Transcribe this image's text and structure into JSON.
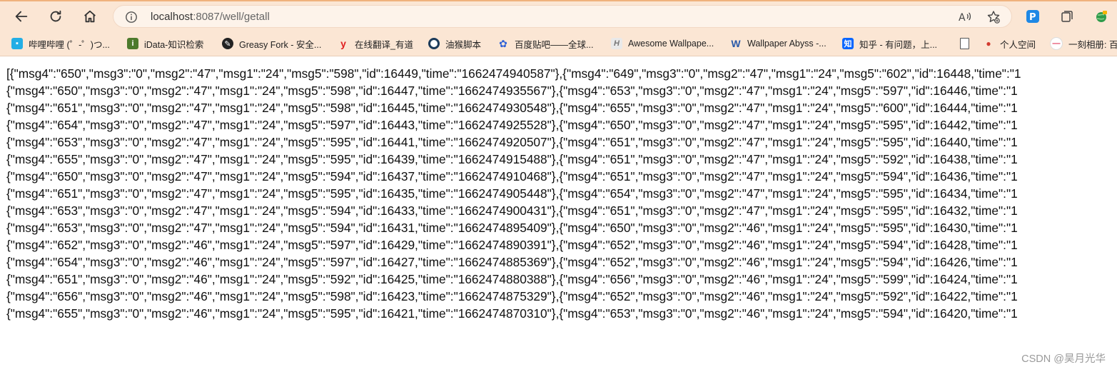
{
  "browser": {
    "address_bar": {
      "host": "localhost",
      "path": ":8087/well/getall"
    },
    "nav": {
      "back_icon": "back-arrow-icon",
      "reload_icon": "reload-icon",
      "home_icon": "home-icon"
    },
    "bookmarks": [
      {
        "label": "哔哩哔哩 (゜-゜)つ...",
        "icon": "bilibili-icon",
        "color": "#23aee5"
      },
      {
        "label": "iData-知识检索",
        "icon": "idata-icon",
        "color": "#4d7a2c"
      },
      {
        "label": "Greasy Fork - 安全...",
        "icon": "greasyfork-icon",
        "color": "#222222"
      },
      {
        "label": "在线翻译_有道",
        "icon": "youdao-icon",
        "color": "#e02020"
      },
      {
        "label": "油猴脚本",
        "icon": "tampermonkey-icon",
        "color": "#1c3b5a"
      },
      {
        "label": "百度贴吧——全球...",
        "icon": "baidu-icon",
        "color": "#2f61d6"
      },
      {
        "label": "Awesome Wallpape...",
        "icon": "wallpaper-icon",
        "color": "#8a8a8a"
      },
      {
        "label": "Wallpaper Abyss -...",
        "icon": "abyss-icon",
        "color": "#2b5aa8"
      },
      {
        "label": "知乎 - 有问题，上...",
        "icon": "zhihu-icon",
        "color": "#0a66ff"
      },
      {
        "label": "",
        "icon": "document-icon",
        "color": "#555555"
      },
      {
        "label": "个人空间",
        "icon": "space-icon",
        "color": "#d23a2f"
      },
      {
        "label": "一刻相册: 百",
        "icon": "yike-icon",
        "color": "#e23b5b"
      }
    ]
  },
  "response_lines": [
    "[{\"msg4\":\"650\",\"msg3\":\"0\",\"msg2\":\"47\",\"msg1\":\"24\",\"msg5\":\"598\",\"id\":16449,\"time\":\"1662474940587\"},{\"msg4\":\"649\",\"msg3\":\"0\",\"msg2\":\"47\",\"msg1\":\"24\",\"msg5\":\"602\",\"id\":16448,\"time\":\"1",
    "{\"msg4\":\"650\",\"msg3\":\"0\",\"msg2\":\"47\",\"msg1\":\"24\",\"msg5\":\"598\",\"id\":16447,\"time\":\"1662474935567\"},{\"msg4\":\"653\",\"msg3\":\"0\",\"msg2\":\"47\",\"msg1\":\"24\",\"msg5\":\"597\",\"id\":16446,\"time\":\"1",
    "{\"msg4\":\"651\",\"msg3\":\"0\",\"msg2\":\"47\",\"msg1\":\"24\",\"msg5\":\"598\",\"id\":16445,\"time\":\"1662474930548\"},{\"msg4\":\"655\",\"msg3\":\"0\",\"msg2\":\"47\",\"msg1\":\"24\",\"msg5\":\"600\",\"id\":16444,\"time\":\"1",
    "{\"msg4\":\"654\",\"msg3\":\"0\",\"msg2\":\"47\",\"msg1\":\"24\",\"msg5\":\"597\",\"id\":16443,\"time\":\"1662474925528\"},{\"msg4\":\"650\",\"msg3\":\"0\",\"msg2\":\"47\",\"msg1\":\"24\",\"msg5\":\"595\",\"id\":16442,\"time\":\"1",
    "{\"msg4\":\"653\",\"msg3\":\"0\",\"msg2\":\"47\",\"msg1\":\"24\",\"msg5\":\"595\",\"id\":16441,\"time\":\"1662474920507\"},{\"msg4\":\"651\",\"msg3\":\"0\",\"msg2\":\"47\",\"msg1\":\"24\",\"msg5\":\"595\",\"id\":16440,\"time\":\"1",
    "{\"msg4\":\"655\",\"msg3\":\"0\",\"msg2\":\"47\",\"msg1\":\"24\",\"msg5\":\"595\",\"id\":16439,\"time\":\"1662474915488\"},{\"msg4\":\"651\",\"msg3\":\"0\",\"msg2\":\"47\",\"msg1\":\"24\",\"msg5\":\"592\",\"id\":16438,\"time\":\"1",
    "{\"msg4\":\"650\",\"msg3\":\"0\",\"msg2\":\"47\",\"msg1\":\"24\",\"msg5\":\"594\",\"id\":16437,\"time\":\"1662474910468\"},{\"msg4\":\"651\",\"msg3\":\"0\",\"msg2\":\"47\",\"msg1\":\"24\",\"msg5\":\"594\",\"id\":16436,\"time\":\"1",
    "{\"msg4\":\"651\",\"msg3\":\"0\",\"msg2\":\"47\",\"msg1\":\"24\",\"msg5\":\"595\",\"id\":16435,\"time\":\"1662474905448\"},{\"msg4\":\"654\",\"msg3\":\"0\",\"msg2\":\"47\",\"msg1\":\"24\",\"msg5\":\"595\",\"id\":16434,\"time\":\"1",
    "{\"msg4\":\"653\",\"msg3\":\"0\",\"msg2\":\"47\",\"msg1\":\"24\",\"msg5\":\"594\",\"id\":16433,\"time\":\"1662474900431\"},{\"msg4\":\"651\",\"msg3\":\"0\",\"msg2\":\"47\",\"msg1\":\"24\",\"msg5\":\"595\",\"id\":16432,\"time\":\"1",
    "{\"msg4\":\"653\",\"msg3\":\"0\",\"msg2\":\"47\",\"msg1\":\"24\",\"msg5\":\"594\",\"id\":16431,\"time\":\"1662474895409\"},{\"msg4\":\"650\",\"msg3\":\"0\",\"msg2\":\"46\",\"msg1\":\"24\",\"msg5\":\"595\",\"id\":16430,\"time\":\"1",
    "{\"msg4\":\"652\",\"msg3\":\"0\",\"msg2\":\"46\",\"msg1\":\"24\",\"msg5\":\"597\",\"id\":16429,\"time\":\"1662474890391\"},{\"msg4\":\"652\",\"msg3\":\"0\",\"msg2\":\"46\",\"msg1\":\"24\",\"msg5\":\"594\",\"id\":16428,\"time\":\"1",
    "{\"msg4\":\"654\",\"msg3\":\"0\",\"msg2\":\"46\",\"msg1\":\"24\",\"msg5\":\"597\",\"id\":16427,\"time\":\"1662474885369\"},{\"msg4\":\"652\",\"msg3\":\"0\",\"msg2\":\"46\",\"msg1\":\"24\",\"msg5\":\"594\",\"id\":16426,\"time\":\"1",
    "{\"msg4\":\"651\",\"msg3\":\"0\",\"msg2\":\"46\",\"msg1\":\"24\",\"msg5\":\"592\",\"id\":16425,\"time\":\"1662474880388\"},{\"msg4\":\"656\",\"msg3\":\"0\",\"msg2\":\"46\",\"msg1\":\"24\",\"msg5\":\"599\",\"id\":16424,\"time\":\"1",
    "{\"msg4\":\"656\",\"msg3\":\"0\",\"msg2\":\"46\",\"msg1\":\"24\",\"msg5\":\"598\",\"id\":16423,\"time\":\"1662474875329\"},{\"msg4\":\"652\",\"msg3\":\"0\",\"msg2\":\"46\",\"msg1\":\"24\",\"msg5\":\"592\",\"id\":16422,\"time\":\"1",
    "{\"msg4\":\"655\",\"msg3\":\"0\",\"msg2\":\"46\",\"msg1\":\"24\",\"msg5\":\"595\",\"id\":16421,\"time\":\"1662474870310\"},{\"msg4\":\"653\",\"msg3\":\"0\",\"msg2\":\"46\",\"msg1\":\"24\",\"msg5\":\"594\",\"id\":16420,\"time\":\"1"
  ],
  "watermark": "CSDN @昊月光华",
  "colors": {
    "toolbar_bg": "#fbe6d4",
    "accent": "#f0b27d"
  }
}
